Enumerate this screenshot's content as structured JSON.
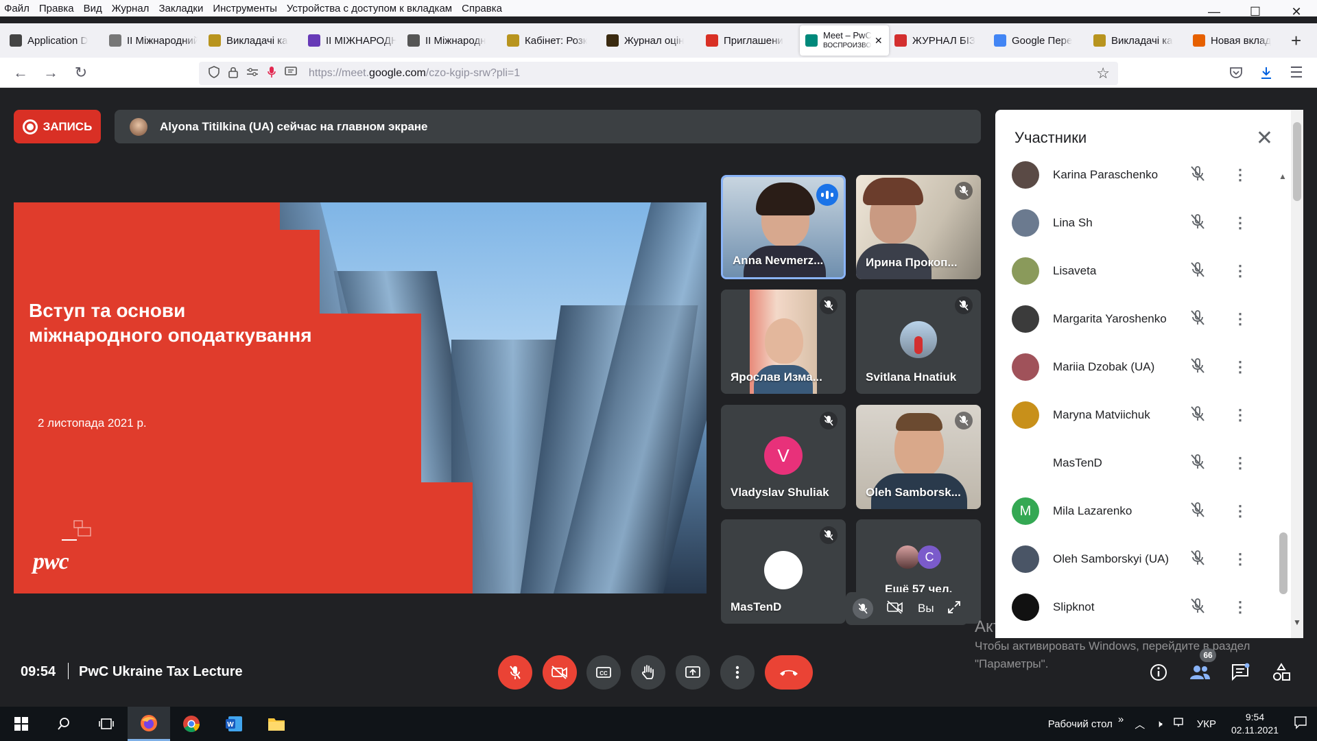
{
  "menu": [
    "Файл",
    "Правка",
    "Вид",
    "Журнал",
    "Закладки",
    "Инструменты",
    "Устройства с доступом к вкладкам",
    "Справка"
  ],
  "window_controls": {
    "minimize": "—",
    "maximize": "☐",
    "close": "✕"
  },
  "tabs": [
    {
      "label": "Application D",
      "icon": "ukraine-trident-icon",
      "color": "#444"
    },
    {
      "label": "II Міжнародний",
      "icon": "blank-page-icon",
      "color": "#777"
    },
    {
      "label": "Викладачі ка",
      "icon": "university-seal-icon",
      "color": "#b8941e"
    },
    {
      "label": "II МІЖНАРОДН",
      "icon": "purple-form-icon",
      "color": "#673ab7"
    },
    {
      "label": "II Міжнародн",
      "icon": "anchor-icon",
      "color": "#555"
    },
    {
      "label": "Кабінет: Розк",
      "icon": "university-seal-icon",
      "color": "#b8941e"
    },
    {
      "label": "Журнал оцін",
      "icon": "journal-icon",
      "color": "#3a2a10"
    },
    {
      "label": "Приглашени",
      "icon": "gmail-icon",
      "color": "#d93025"
    },
    {
      "label": "Meet – PwC",
      "label2": "ВОСПРОИЗВО",
      "icon": "meet-icon",
      "color": "#00897b",
      "active": true
    },
    {
      "label": "ЖУРНАЛ БІЗ",
      "icon": "journal-red-icon",
      "color": "#d32f2f"
    },
    {
      "label": "Google Пере",
      "icon": "translate-icon",
      "color": "#4285f4"
    },
    {
      "label": "Викладачі ка",
      "icon": "university-seal-icon",
      "color": "#b8941e"
    },
    {
      "label": "Новая вклад",
      "icon": "firefox-icon",
      "color": "#e66000"
    }
  ],
  "address": {
    "prefix": "https://meet.",
    "domain": "google.com",
    "path": "/czo-kgip-srw?pli=1"
  },
  "recording_label": "ЗАПИСЬ",
  "presenting_text": "Alyona Titilkina (UA) сейчас на главном экране",
  "slide": {
    "title_line1": "Вступ та основи",
    "title_line2": "міжнародного оподаткування",
    "date": "2 листопада 2021 р.",
    "logo": "pwc"
  },
  "tiles": [
    {
      "name": "Anna Nevmerz...",
      "speaking": true
    },
    {
      "name": "Ирина Прокоп..."
    },
    {
      "name": "Ярослав Изма..."
    },
    {
      "name": "Svitlana Hnatiuk"
    },
    {
      "name": "Vladyslav Shuliak",
      "initial": "V",
      "color": "#e8317a"
    },
    {
      "name": "Oleh Samborsk..."
    },
    {
      "name": "MasTenD"
    },
    {
      "name": "Ещё 57 чел.",
      "initial": "C",
      "color": "#7b5bcb"
    }
  ],
  "self_label": "Вы",
  "panel": {
    "title": "Участники",
    "participants": [
      {
        "name": "Karina Paraschenko",
        "color": "#5a4a45"
      },
      {
        "name": "Lina Sh",
        "color": "#6b7a8f"
      },
      {
        "name": "Lisaveta",
        "color": "#8a9a5b"
      },
      {
        "name": "Margarita Yaroshenko",
        "color": "#3b3b3b"
      },
      {
        "name": "Mariia Dzobak (UA)",
        "color": "#a0525a"
      },
      {
        "name": "Maryna Matviichuk",
        "color": "#c8901a"
      },
      {
        "name": "MasTenD",
        "color": "#ffffff"
      },
      {
        "name": "Mila Lazarenko",
        "initial": "M",
        "color": "#34a853"
      },
      {
        "name": "Oleh Samborskyi (UA)",
        "color": "#4a5566"
      },
      {
        "name": "Slipknot",
        "color": "#111111"
      }
    ]
  },
  "watermark": {
    "line1": "Активация Windows",
    "line2": "Чтобы активировать Windows, перейдите в раздел",
    "line3": "\"Параметры\"."
  },
  "bottom": {
    "time": "09:54",
    "meeting_name": "PwC Ukraine Tax Lecture",
    "people_count": "66"
  },
  "taskbar": {
    "desktop_label": "Рабочий стол",
    "lang": "УКР",
    "time": "9:54",
    "date": "02.11.2021",
    "chevron": "»"
  }
}
